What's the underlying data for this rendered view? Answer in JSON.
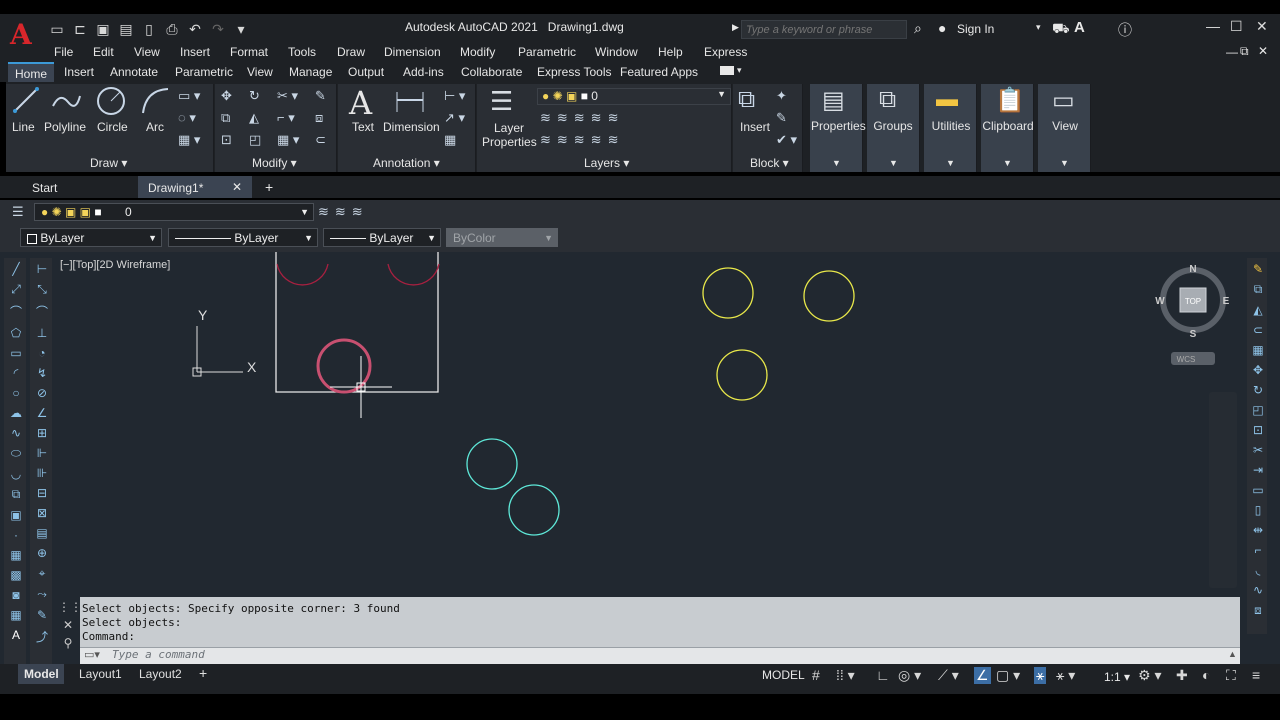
{
  "app": {
    "title": "Autodesk AutoCAD 2021",
    "document": "Drawing1.dwg",
    "logo_letter": "A",
    "search_placeholder": "Type a keyword or phrase",
    "signin": "Sign In"
  },
  "menu": [
    "File",
    "Edit",
    "View",
    "Insert",
    "Format",
    "Tools",
    "Draw",
    "Dimension",
    "Modify",
    "Parametric",
    "Window",
    "Help",
    "Express"
  ],
  "ribbon_tabs": [
    "Home",
    "Insert",
    "Annotate",
    "Parametric",
    "View",
    "Manage",
    "Output",
    "Add-ins",
    "Collaborate",
    "Express Tools",
    "Featured Apps"
  ],
  "ribbon": {
    "draw": {
      "title": "Draw",
      "line": "Line",
      "polyline": "Polyline",
      "circle": "Circle",
      "arc": "Arc"
    },
    "modify": {
      "title": "Modify"
    },
    "annotation": {
      "title": "Annotation",
      "text": "Text",
      "dimension": "Dimension"
    },
    "layers": {
      "title": "Layers",
      "layer_properties_1": "Layer",
      "layer_properties_2": "Properties",
      "current_layer": "0"
    },
    "block": {
      "title": "Block",
      "insert": "Insert"
    },
    "properties": "Properties",
    "groups": "Groups",
    "utilities": "Utilities",
    "clipboard": "Clipboard",
    "view": "View"
  },
  "file_tabs": {
    "start": "Start",
    "drawing": "Drawing1*"
  },
  "layer_toolbar": {
    "layer": "0",
    "color": "ByLayer",
    "linetype": "ByLayer",
    "lineweight": "ByLayer",
    "plotstyle": "ByColor"
  },
  "viewport": {
    "label": "[−][Top][2D Wireframe]",
    "ucs_x": "X",
    "ucs_y": "Y",
    "viewcube": {
      "n": "N",
      "s": "S",
      "e": "E",
      "w": "W",
      "top": "TOP",
      "wcs": "WCS"
    }
  },
  "colors": {
    "red_circle": "#c83550",
    "yellow_circle": "#e8e84a",
    "cyan_circle": "#5ee8d8",
    "canvas": "#212830",
    "accent": "#3c9ad8"
  },
  "command": {
    "history": [
      "Select objects: Specify opposite corner: 3 found",
      "Select objects:",
      "Command:"
    ],
    "placeholder": "Type a command"
  },
  "layout_tabs": {
    "model": "Model",
    "layout1": "Layout1",
    "layout2": "Layout2"
  },
  "status": {
    "model": "MODEL",
    "scale": "1:1"
  }
}
